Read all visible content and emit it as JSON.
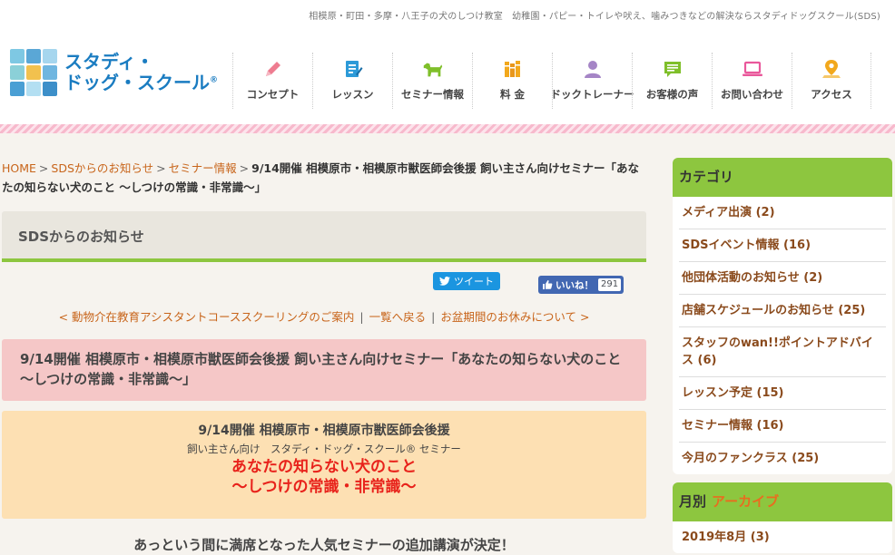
{
  "header": {
    "tagline": "相模原・町田・多摩・八王子の犬のしつけ教室　幼稚園・パピー・トイレや吠え、噛みつきなどの解決ならスタディドッグスクール(SDS)",
    "logo_line1": "スタディ・",
    "logo_line2": "ドッグ・スクール",
    "logo_mark": "®"
  },
  "nav": [
    {
      "label": "コンセプト",
      "icon": "pencil-icon",
      "color": "#ee7c90"
    },
    {
      "label": "レッスン",
      "icon": "notebook-icon",
      "color": "#2c9ad8"
    },
    {
      "label": "セミナー情報",
      "icon": "dog-icon",
      "color": "#7fbf2a"
    },
    {
      "label": "料 金",
      "icon": "books-icon",
      "color": "#f2a81c"
    },
    {
      "label": "ドックトレーナー",
      "icon": "person-icon",
      "color": "#a585c6"
    },
    {
      "label": "お客様の声",
      "icon": "message-icon",
      "color": "#7fbf2a"
    },
    {
      "label": "お問い合わせ",
      "icon": "laptop-icon",
      "color": "#e9589b"
    },
    {
      "label": "アクセス",
      "icon": "map-pin-icon",
      "color": "#f2a81c"
    }
  ],
  "breadcrumb": {
    "home": "HOME",
    "news": "SDSからのお知らせ",
    "seminar": "セミナー情報",
    "current": "9/14開催 相模原市・相模原市獣医師会後援 飼い主さん向けセミナー「あなたの知らない犬のこと ～しつけの常識・非常識～」",
    "sep": ">"
  },
  "section_title": "SDSからのお知らせ",
  "social": {
    "tweet": "ツイート",
    "like": "いいね！",
    "like_count": "291"
  },
  "post_nav": {
    "prev": "< 動物介在教育アシスタントコーススクーリングのご案内",
    "list": "一覧へ戻る",
    "next": "お盆期間のお休みについて >",
    "bar": "|"
  },
  "post": {
    "title": "9/14開催 相模原市・相模原市獣医師会後援 飼い主さん向けセミナー「あなたの知らない犬のこと ～しつけの常識・非常識～」",
    "box_line1": "9/14開催 相模原市・相模原市獣医師会後援",
    "box_line2": "飼い主さん向け　スタディ・ドッグ・スクール® セミナー",
    "box_line3": "あなたの知らない犬のこと",
    "box_line4": "～しつけの常識・非常識～",
    "lead": "あっという間に満席となった人気セミナーの追加講演が決定！"
  },
  "sidebar": {
    "category_title": "カテゴリ",
    "categories": [
      "メディア出演 (2)",
      "SDSイベント情報 (16)",
      "他団体活動のお知らせ (2)",
      "店舗スケジュールのお知らせ (25)",
      "スタッフのwan!!ポイントアドバイス (6)",
      "レッスン予定 (15)",
      "セミナー情報 (16)",
      "今月のファンクラス (25)"
    ],
    "archive_title_1": "月別",
    "archive_title_2": "アーカイブ",
    "archives": [
      "2019年8月 (3)"
    ]
  },
  "colors": {
    "accent_green": "#8dc63f",
    "link_orange": "#c8651b",
    "title_pink": "#f5c7c7",
    "box_orange": "#fde0b3",
    "highlight_red": "#e8221b",
    "logo_blue": "#1a7cc1"
  }
}
